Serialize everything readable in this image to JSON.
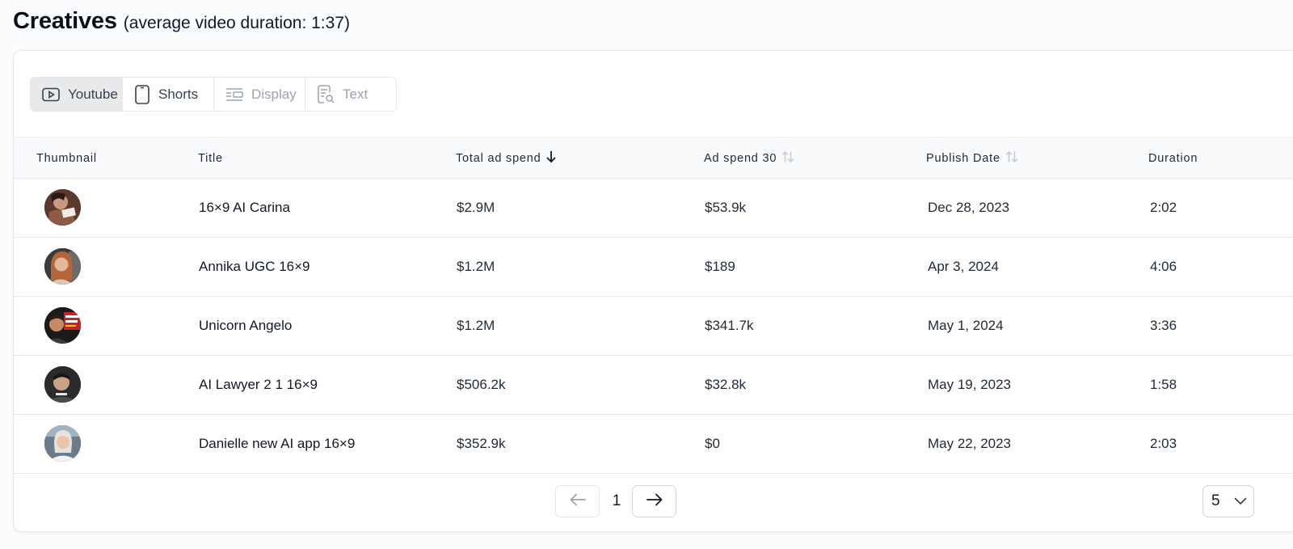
{
  "header": {
    "title": "Creatives",
    "subtitle": "(average video duration: 1:37)"
  },
  "tabs": [
    {
      "label": "Youtube",
      "icon": "video-play-icon",
      "state": "active"
    },
    {
      "label": "Shorts",
      "icon": "phone-icon",
      "state": "normal"
    },
    {
      "label": "Display",
      "icon": "display-layout-icon",
      "state": "disabled"
    },
    {
      "label": "Text",
      "icon": "text-search-icon",
      "state": "disabled"
    }
  ],
  "columns": {
    "thumbnail": "Thumbnail",
    "title": "Title",
    "total_ad_spend": "Total ad spend",
    "ad_spend_30": "Ad spend 30",
    "publish_date": "Publish Date",
    "duration": "Duration"
  },
  "sort": {
    "column": "total_ad_spend",
    "direction": "descending"
  },
  "rows": [
    {
      "title": "16×9 AI Carina",
      "total_ad_spend": "$2.9M",
      "ad_spend_30": "$53.9k",
      "publish_date": "Dec 28, 2023",
      "duration": "2:02"
    },
    {
      "title": "Annika UGC 16×9",
      "total_ad_spend": "$1.2M",
      "ad_spend_30": "$189",
      "publish_date": "Apr 3, 2024",
      "duration": "4:06"
    },
    {
      "title": "Unicorn Angelo",
      "total_ad_spend": "$1.2M",
      "ad_spend_30": "$341.7k",
      "publish_date": "May 1, 2024",
      "duration": "3:36"
    },
    {
      "title": "AI Lawyer 2 1 16×9",
      "total_ad_spend": "$506.2k",
      "ad_spend_30": "$32.8k",
      "publish_date": "May 19, 2023",
      "duration": "1:58"
    },
    {
      "title": "Danielle new AI app 16×9",
      "total_ad_spend": "$352.9k",
      "ad_spend_30": "$0",
      "publish_date": "May 22, 2023",
      "duration": "2:03"
    }
  ],
  "pagination": {
    "current_page": "1",
    "page_size": "5"
  },
  "colors": {
    "accent_text": "#111827",
    "muted": "#9ca3af",
    "border": "#e5e7eb",
    "active_tab_bg": "#e8e9eb"
  }
}
